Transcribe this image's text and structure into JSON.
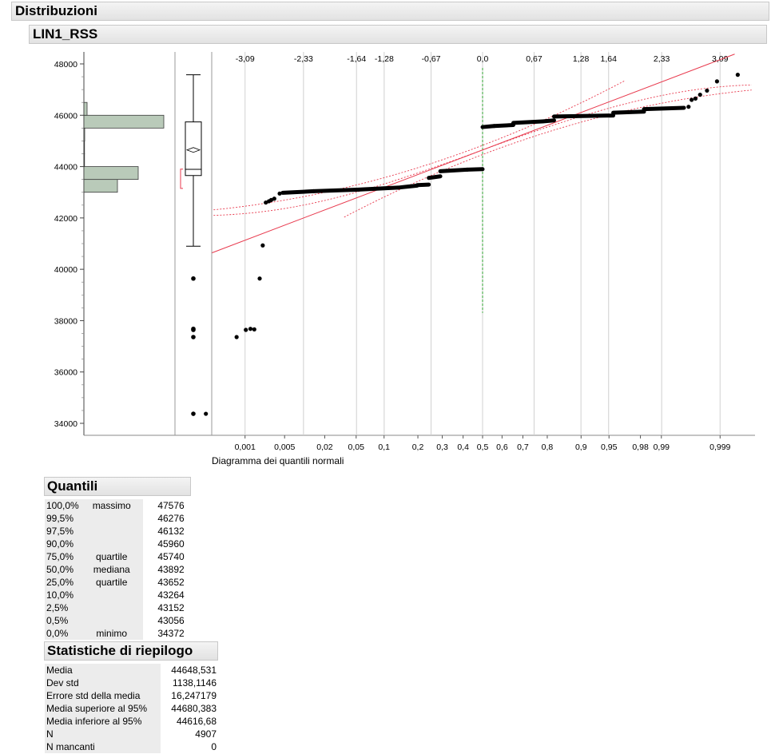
{
  "report": {
    "section_title": "Distribuzioni",
    "variable_title": "LIN1_RSS"
  },
  "chart_data": {
    "type": "scatter",
    "variable": "LIN1_RSS",
    "ylim": [
      33500,
      48500
    ],
    "y_ticks": [
      34000,
      36000,
      38000,
      40000,
      42000,
      44000,
      46000,
      48000
    ],
    "y_tick_labels": [
      "34000",
      "36000",
      "38000",
      "40000",
      "42000",
      "44000",
      "46000",
      "48000"
    ],
    "xlabel": "Diagramma dei quantili normali",
    "z_ticks": [
      -3.09,
      -2.33,
      -1.64,
      -1.28,
      -0.67,
      0.0,
      0.67,
      1.28,
      1.64,
      2.33,
      3.09
    ],
    "z_tick_labels": [
      "-3,09",
      "-2,33",
      "-1,64",
      "-1,28",
      "-0,67",
      "0,0",
      "0,67",
      "1,28",
      "1,64",
      "2,33",
      "3,09"
    ],
    "p_ticks": [
      0.001,
      0.005,
      0.02,
      0.05,
      0.1,
      0.2,
      0.3,
      0.4,
      0.5,
      0.6,
      0.7,
      0.8,
      0.9,
      0.95,
      0.98,
      0.99,
      0.999
    ],
    "p_tick_labels": [
      "0,001",
      "0,005",
      "0,02",
      "0,05",
      "0,1",
      "0,2",
      "0,3",
      "0,4",
      "0,5",
      "0,6",
      "0,7",
      "0,8",
      "0,9",
      "0,95",
      "0,98",
      "0,99",
      "0,999"
    ],
    "histogram": {
      "bins": [
        {
          "from": 43000,
          "to": 43500,
          "count": 0.42
        },
        {
          "from": 43500,
          "to": 44000,
          "count": 0.68
        },
        {
          "from": 44000,
          "to": 44500,
          "count": 0.0
        },
        {
          "from": 44500,
          "to": 45000,
          "count": 0.0
        },
        {
          "from": 45000,
          "to": 45500,
          "count": 0.01
        },
        {
          "from": 45500,
          "to": 46000,
          "count": 1.0
        },
        {
          "from": 46000,
          "to": 46500,
          "count": 0.04
        }
      ],
      "color": "#b9cab9"
    },
    "boxplot": {
      "min_whisker": 40900,
      "q1": 43652,
      "median": 43892,
      "q3": 45740,
      "max_whisker": 47576,
      "mean": 44648.531,
      "mean_ci": [
        44616.68,
        44680.383
      ],
      "shortest_half": [
        43150,
        43900
      ],
      "outliers": [
        39640,
        37680,
        37640,
        37360,
        34372
      ]
    },
    "normal_line": {
      "intercept": 44648.531,
      "slope": 1138.1146
    },
    "points_low": [
      [
        -3.6,
        34372
      ],
      [
        -3.2,
        37360
      ],
      [
        -3.08,
        37640
      ],
      [
        -3.02,
        37680
      ],
      [
        -2.97,
        37660
      ],
      [
        -2.9,
        39640
      ],
      [
        -2.86,
        40930
      ],
      [
        -2.82,
        42600
      ],
      [
        -2.78,
        42650
      ],
      [
        -2.75,
        42700
      ],
      [
        -2.71,
        42750
      ],
      [
        -2.64,
        42950
      ]
    ],
    "points_high": [
      [
        2.68,
        46330
      ],
      [
        2.72,
        46600
      ],
      [
        2.77,
        46650
      ],
      [
        2.83,
        46800
      ],
      [
        2.92,
        46960
      ],
      [
        3.05,
        47320
      ],
      [
        3.32,
        47576
      ]
    ],
    "step_segments": [
      [
        -2.6,
        42980,
        -2.2,
        43040
      ],
      [
        -2.2,
        43040,
        -1.64,
        43100
      ],
      [
        -1.64,
        43100,
        -1.1,
        43180
      ],
      [
        -1.1,
        43180,
        -0.85,
        43260
      ],
      [
        -0.85,
        43280,
        -0.7,
        43300
      ],
      [
        -0.7,
        43560,
        -0.55,
        43620
      ],
      [
        -0.55,
        43820,
        -0.2,
        43880
      ],
      [
        -0.2,
        43880,
        0.0,
        43900
      ],
      [
        0.0,
        45540,
        0.15,
        45580
      ],
      [
        0.15,
        45580,
        0.4,
        45620
      ],
      [
        0.4,
        45700,
        0.78,
        45760
      ],
      [
        0.78,
        45760,
        0.93,
        45800
      ],
      [
        0.93,
        45950,
        1.7,
        45990
      ],
      [
        1.7,
        46100,
        2.1,
        46140
      ],
      [
        2.1,
        46240,
        2.62,
        46290
      ]
    ],
    "colors": {
      "points": "#000000",
      "fit_line": "#e8394d",
      "ci_band": "#e8394d",
      "median_line": "#2ca02c",
      "grid": "#d0d0d0"
    }
  },
  "quantiles": {
    "title": "Quantili",
    "rows": [
      {
        "pct": "100,0%",
        "label": "massimo",
        "value": "47576"
      },
      {
        "pct": "99,5%",
        "label": "",
        "value": "46276"
      },
      {
        "pct": "97,5%",
        "label": "",
        "value": "46132"
      },
      {
        "pct": "90,0%",
        "label": "",
        "value": "45960"
      },
      {
        "pct": "75,0%",
        "label": "quartile",
        "value": "45740"
      },
      {
        "pct": "50,0%",
        "label": "mediana",
        "value": "43892"
      },
      {
        "pct": "25,0%",
        "label": "quartile",
        "value": "43652"
      },
      {
        "pct": "10,0%",
        "label": "",
        "value": "43264"
      },
      {
        "pct": "2,5%",
        "label": "",
        "value": "43152"
      },
      {
        "pct": "0,5%",
        "label": "",
        "value": "43056"
      },
      {
        "pct": "0,0%",
        "label": "minimo",
        "value": "34372"
      }
    ]
  },
  "summary": {
    "title": "Statistiche di riepilogo",
    "rows": [
      {
        "label": "Media",
        "value": "44648,531"
      },
      {
        "label": "Dev std",
        "value": "1138,1146"
      },
      {
        "label": "Errore std della media",
        "value": "16,247179"
      },
      {
        "label": "Media superiore al 95%",
        "value": "44680,383"
      },
      {
        "label": "Media inferiore al 95%",
        "value": "44616,68"
      },
      {
        "label": "N",
        "value": "4907"
      },
      {
        "label": "N mancanti",
        "value": "0"
      }
    ]
  }
}
